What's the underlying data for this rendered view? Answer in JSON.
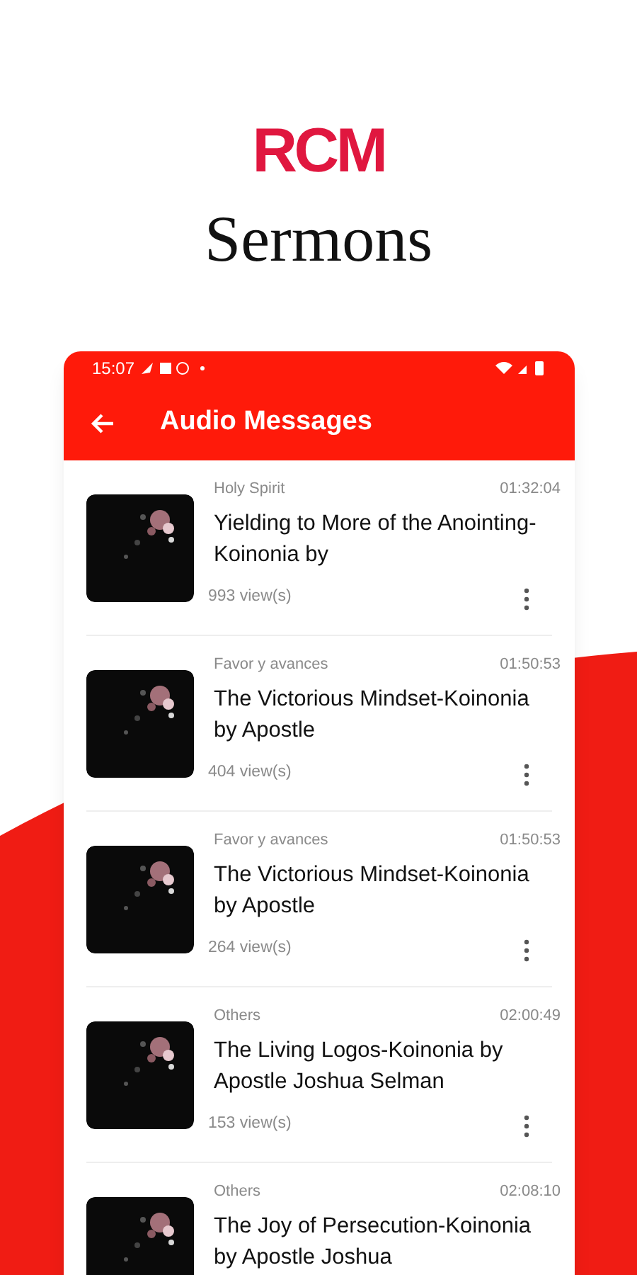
{
  "logo": {
    "text": "RCM"
  },
  "heading": "Sermons",
  "status_bar": {
    "time": "15:07"
  },
  "app_bar": {
    "title": "Audio Messages"
  },
  "messages": [
    {
      "category": "Holy Spirit",
      "duration": "01:32:04",
      "title": "Yielding to More of the Anointing-Koinonia by",
      "views": "993 view(s)"
    },
    {
      "category": "Favor y avances",
      "duration": "01:50:53",
      "title": "The Victorious Mindset-Koinonia by Apostle",
      "views": "404 view(s)"
    },
    {
      "category": "Favor y avances",
      "duration": "01:50:53",
      "title": "The Victorious Mindset-Koinonia by Apostle",
      "views": "264 view(s)"
    },
    {
      "category": "Others",
      "duration": "02:00:49",
      "title": "The Living Logos-Koinonia by Apostle Joshua Selman",
      "views": "153 view(s)"
    },
    {
      "category": "Others",
      "duration": "02:08:10",
      "title": "The Joy of Persecution-Koinonia by Apostle Joshua"
    }
  ]
}
